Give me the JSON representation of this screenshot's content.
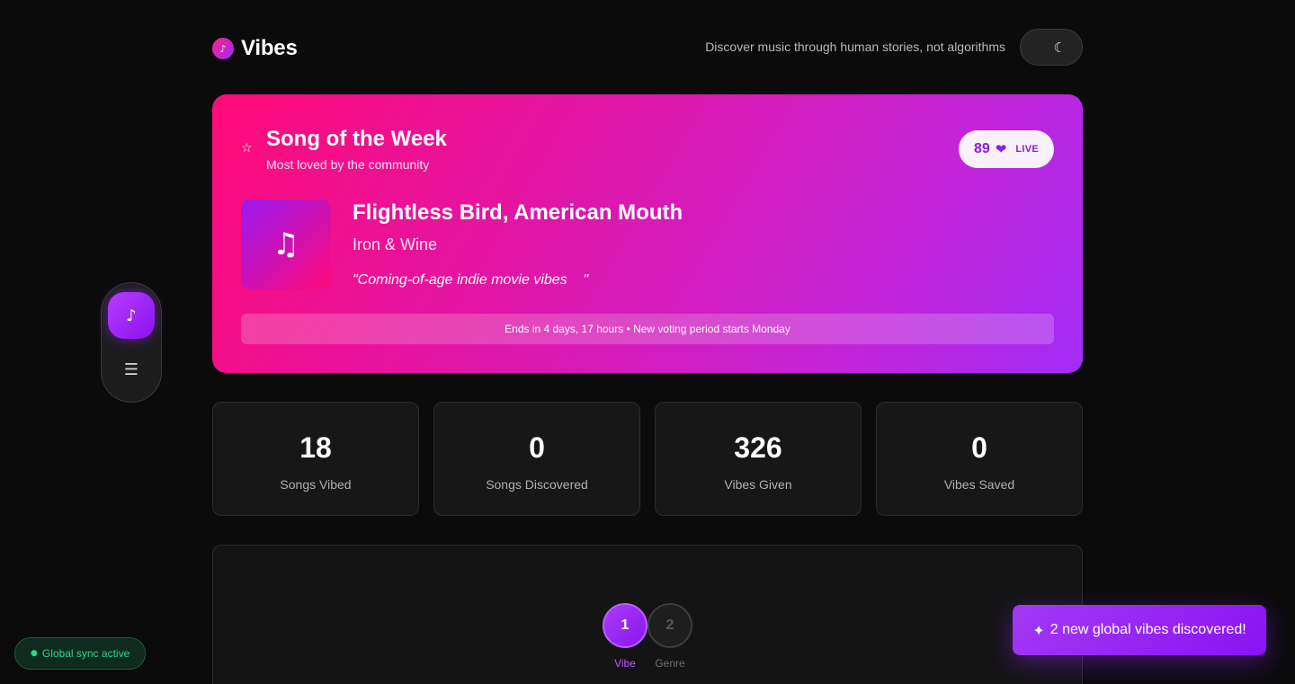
{
  "header": {
    "logo_icon": "music-note-icon",
    "logo_text": "Vibes",
    "tagline": "Discover music through human stories, not algorithms",
    "theme_toggle_icon": "moon-icon",
    "theme_toggle_glyph": "☾"
  },
  "song_of_week": {
    "star_glyph": "☆",
    "title": "Song of the Week",
    "subtitle": "Most loved by the community",
    "vote_count": "89",
    "heart_glyph": "❤",
    "live_label": "LIVE",
    "album_glyph": "♫",
    "song_title": "Flightless Bird, American Mouth",
    "artist": "Iron & Wine",
    "quote": "\"Coming-of-age indie movie vibes    \"",
    "ends_text": "Ends in 4 days, 17 hours • New voting period starts Monday",
    "colors": {
      "gradient_start": "#ff0a78",
      "gradient_end": "#a22cf5"
    }
  },
  "stats": [
    {
      "value": "18",
      "label": "Songs Vibed"
    },
    {
      "value": "0",
      "label": "Songs Discovered"
    },
    {
      "value": "326",
      "label": "Vibes Given"
    },
    {
      "value": "0",
      "label": "Vibes Saved"
    }
  ],
  "steps": [
    {
      "number": "1",
      "label": "Vibe",
      "active": true
    },
    {
      "number": "2",
      "label": "Genre",
      "active": false
    }
  ],
  "side_nav": [
    {
      "icon": "music-icon",
      "glyph": "♪",
      "active": true
    },
    {
      "icon": "list-icon",
      "glyph": "☰",
      "active": false
    }
  ],
  "sync_badge": {
    "glyph": "●",
    "text": "Global sync active",
    "color": "#2ad88a"
  },
  "toast": {
    "glyph": "✦",
    "text": "2 new global vibes discovered!"
  },
  "colors": {
    "accent": "#9b2cf6",
    "background": "#0b0b0b",
    "card": "#171717"
  }
}
